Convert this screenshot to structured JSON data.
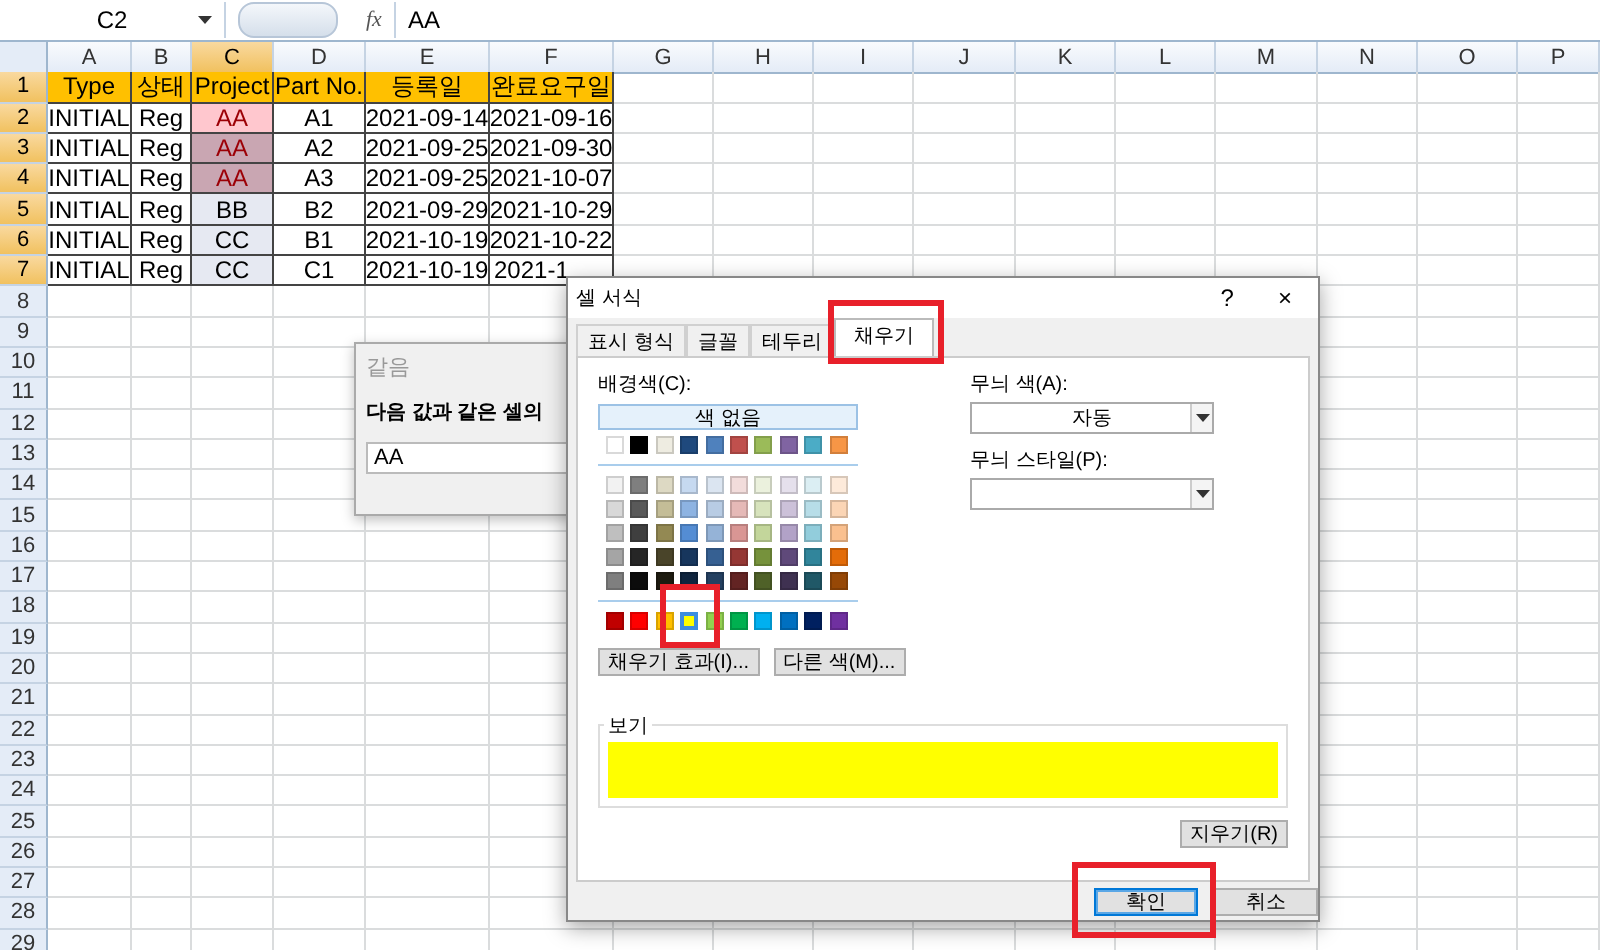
{
  "formula_bar": {
    "name_box": "C2",
    "fx": "fx",
    "value": "AA"
  },
  "sheet": {
    "columns": [
      {
        "label": "A",
        "selected": false
      },
      {
        "label": "B",
        "selected": false
      },
      {
        "label": "C",
        "selected": true
      },
      {
        "label": "D",
        "selected": false
      },
      {
        "label": "E",
        "selected": false
      },
      {
        "label": "F",
        "selected": false
      },
      {
        "label": "G",
        "selected": false
      },
      {
        "label": "H",
        "selected": false
      },
      {
        "label": "I",
        "selected": false
      },
      {
        "label": "J",
        "selected": false
      },
      {
        "label": "K",
        "selected": false
      },
      {
        "label": "L",
        "selected": false
      },
      {
        "label": "M",
        "selected": false
      },
      {
        "label": "N",
        "selected": false
      },
      {
        "label": "O",
        "selected": false
      },
      {
        "label": "P",
        "selected": false
      }
    ],
    "row_numbers": [
      {
        "label": "1",
        "selected": true
      },
      {
        "label": "2",
        "selected": true
      },
      {
        "label": "3",
        "selected": true
      },
      {
        "label": "4",
        "selected": true
      },
      {
        "label": "5",
        "selected": true
      },
      {
        "label": "6",
        "selected": true
      },
      {
        "label": "7",
        "selected": true
      },
      {
        "label": "8",
        "selected": false
      },
      {
        "label": "9",
        "selected": false
      },
      {
        "label": "10",
        "selected": false
      },
      {
        "label": "11",
        "selected": false
      },
      {
        "label": "12",
        "selected": false
      },
      {
        "label": "13",
        "selected": false
      },
      {
        "label": "14",
        "selected": false
      },
      {
        "label": "15",
        "selected": false
      },
      {
        "label": "16",
        "selected": false
      },
      {
        "label": "17",
        "selected": false
      },
      {
        "label": "18",
        "selected": false
      },
      {
        "label": "19",
        "selected": false
      },
      {
        "label": "20",
        "selected": false
      },
      {
        "label": "21",
        "selected": false
      },
      {
        "label": "22",
        "selected": false
      },
      {
        "label": "23",
        "selected": false
      },
      {
        "label": "24",
        "selected": false
      },
      {
        "label": "25",
        "selected": false
      },
      {
        "label": "26",
        "selected": false
      },
      {
        "label": "27",
        "selected": false
      },
      {
        "label": "28",
        "selected": false
      },
      {
        "label": "29",
        "selected": false
      }
    ],
    "rows": [
      {
        "cells": [
          {
            "text": "Type",
            "kind": "header",
            "selected": false
          },
          {
            "text": "상태",
            "kind": "header",
            "selected": false
          },
          {
            "text": "Project",
            "kind": "header",
            "selected": false
          },
          {
            "text": "Part No.",
            "kind": "header",
            "selected": false
          },
          {
            "text": "등록일",
            "kind": "header",
            "selected": false
          },
          {
            "text": "완료요구일",
            "kind": "header",
            "selected": false
          }
        ]
      },
      {
        "cells": [
          {
            "text": "INITIAL",
            "kind": "plain",
            "selected": false
          },
          {
            "text": "Reg",
            "kind": "plain",
            "selected": false
          },
          {
            "text": "AA",
            "kind": "duplicate",
            "selected": false
          },
          {
            "text": "A1",
            "kind": "plain",
            "selected": false
          },
          {
            "text": "2021-09-14",
            "kind": "plain",
            "selected": false
          },
          {
            "text": "2021-09-16",
            "kind": "plain",
            "selected": false
          }
        ]
      },
      {
        "cells": [
          {
            "text": "INITIAL",
            "kind": "plain",
            "selected": false
          },
          {
            "text": "Reg",
            "kind": "plain",
            "selected": false
          },
          {
            "text": "AA",
            "kind": "duplicate",
            "selected": true
          },
          {
            "text": "A2",
            "kind": "plain",
            "selected": false
          },
          {
            "text": "2021-09-25",
            "kind": "plain",
            "selected": false
          },
          {
            "text": "2021-09-30",
            "kind": "plain",
            "selected": false
          }
        ]
      },
      {
        "cells": [
          {
            "text": "INITIAL",
            "kind": "plain",
            "selected": false
          },
          {
            "text": "Reg",
            "kind": "plain",
            "selected": false
          },
          {
            "text": "AA",
            "kind": "duplicate",
            "selected": true
          },
          {
            "text": "A3",
            "kind": "plain",
            "selected": false
          },
          {
            "text": "2021-09-25",
            "kind": "plain",
            "selected": false
          },
          {
            "text": "2021-10-07",
            "kind": "plain",
            "selected": false
          }
        ]
      },
      {
        "cells": [
          {
            "text": "INITIAL",
            "kind": "plain",
            "selected": false
          },
          {
            "text": "Reg",
            "kind": "plain",
            "selected": false
          },
          {
            "text": "BB",
            "kind": "plain",
            "selected": true
          },
          {
            "text": "B2",
            "kind": "plain",
            "selected": false
          },
          {
            "text": "2021-09-29",
            "kind": "plain",
            "selected": false
          },
          {
            "text": "2021-10-29",
            "kind": "plain",
            "selected": false
          }
        ]
      },
      {
        "cells": [
          {
            "text": "INITIAL",
            "kind": "plain",
            "selected": false
          },
          {
            "text": "Reg",
            "kind": "plain",
            "selected": false
          },
          {
            "text": "CC",
            "kind": "plain",
            "selected": true
          },
          {
            "text": "B1",
            "kind": "plain",
            "selected": false
          },
          {
            "text": "2021-10-19",
            "kind": "plain",
            "selected": false
          },
          {
            "text": "2021-10-22",
            "kind": "plain",
            "selected": false
          }
        ]
      },
      {
        "cells": [
          {
            "text": "INITIAL",
            "kind": "plain",
            "selected": false
          },
          {
            "text": "Reg",
            "kind": "plain",
            "selected": false
          },
          {
            "text": "CC",
            "kind": "plain",
            "selected": true
          },
          {
            "text": "C1",
            "kind": "plain",
            "selected": false
          },
          {
            "text": "2021-10-19",
            "kind": "plain",
            "selected": false
          },
          {
            "text": "2021-1",
            "kind": "plain",
            "selected": false
          }
        ]
      }
    ]
  },
  "duplicate_dialog": {
    "title": "같음",
    "prompt": "다음 값과 같은 셀의",
    "value": "AA"
  },
  "format_dialog": {
    "title": "셀 서식",
    "help": "?",
    "close": "×",
    "tabs": [
      {
        "label": "표시 형식",
        "selected": false
      },
      {
        "label": "글꼴",
        "selected": false
      },
      {
        "label": "테두리",
        "selected": false
      },
      {
        "label": "채우기",
        "selected": true
      }
    ],
    "background_label": "배경색(C):",
    "no_color_button": "색 없음",
    "theme_colors": [
      {
        "color": "#ffffff",
        "selected": false
      },
      {
        "color": "#000000",
        "selected": false
      },
      {
        "color": "#eeece1",
        "selected": false
      },
      {
        "color": "#1f497d",
        "selected": false
      },
      {
        "color": "#4f81bd",
        "selected": false
      },
      {
        "color": "#c0504d",
        "selected": false
      },
      {
        "color": "#9bbb59",
        "selected": false
      },
      {
        "color": "#8064a2",
        "selected": false
      },
      {
        "color": "#4bacc6",
        "selected": false
      },
      {
        "color": "#f79646",
        "selected": false
      }
    ],
    "tint_rows": [
      [
        {
          "color": "#f2f2f2",
          "selected": false
        },
        {
          "color": "#7f7f7f",
          "selected": false
        },
        {
          "color": "#ddd9c3",
          "selected": false
        },
        {
          "color": "#c6d9f0",
          "selected": false
        },
        {
          "color": "#dbe5f1",
          "selected": false
        },
        {
          "color": "#f2dcdb",
          "selected": false
        },
        {
          "color": "#ebf1dd",
          "selected": false
        },
        {
          "color": "#e5e0ec",
          "selected": false
        },
        {
          "color": "#dbeef3",
          "selected": false
        },
        {
          "color": "#fdeada",
          "selected": false
        }
      ],
      [
        {
          "color": "#d8d8d8",
          "selected": false
        },
        {
          "color": "#595959",
          "selected": false
        },
        {
          "color": "#c4bd97",
          "selected": false
        },
        {
          "color": "#8db3e2",
          "selected": false
        },
        {
          "color": "#b8cce4",
          "selected": false
        },
        {
          "color": "#e5b9b7",
          "selected": false
        },
        {
          "color": "#d7e3bc",
          "selected": false
        },
        {
          "color": "#ccc1d9",
          "selected": false
        },
        {
          "color": "#b7dde8",
          "selected": false
        },
        {
          "color": "#fbd5b5",
          "selected": false
        }
      ],
      [
        {
          "color": "#bfbfbf",
          "selected": false
        },
        {
          "color": "#3f3f3f",
          "selected": false
        },
        {
          "color": "#938953",
          "selected": false
        },
        {
          "color": "#548dd4",
          "selected": false
        },
        {
          "color": "#95b3d7",
          "selected": false
        },
        {
          "color": "#d99694",
          "selected": false
        },
        {
          "color": "#c3d69b",
          "selected": false
        },
        {
          "color": "#b2a2c7",
          "selected": false
        },
        {
          "color": "#92cddc",
          "selected": false
        },
        {
          "color": "#fac08f",
          "selected": false
        }
      ],
      [
        {
          "color": "#a5a5a5",
          "selected": false
        },
        {
          "color": "#262626",
          "selected": false
        },
        {
          "color": "#494429",
          "selected": false
        },
        {
          "color": "#17365d",
          "selected": false
        },
        {
          "color": "#366092",
          "selected": false
        },
        {
          "color": "#953734",
          "selected": false
        },
        {
          "color": "#76923c",
          "selected": false
        },
        {
          "color": "#5f497a",
          "selected": false
        },
        {
          "color": "#31859b",
          "selected": false
        },
        {
          "color": "#e36c09",
          "selected": false
        }
      ],
      [
        {
          "color": "#7f7f7f",
          "selected": false
        },
        {
          "color": "#0c0c0c",
          "selected": false
        },
        {
          "color": "#1d1b10",
          "selected": false
        },
        {
          "color": "#0f243e",
          "selected": false
        },
        {
          "color": "#244061",
          "selected": false
        },
        {
          "color": "#632423",
          "selected": false
        },
        {
          "color": "#4f6128",
          "selected": false
        },
        {
          "color": "#3f3151",
          "selected": false
        },
        {
          "color": "#205867",
          "selected": false
        },
        {
          "color": "#974806",
          "selected": false
        }
      ]
    ],
    "standard_colors": [
      {
        "color": "#c00000",
        "selected": false
      },
      {
        "color": "#ff0000",
        "selected": false
      },
      {
        "color": "#ffc000",
        "selected": false
      },
      {
        "color": "#ffff00",
        "selected": true
      },
      {
        "color": "#92d050",
        "selected": false
      },
      {
        "color": "#00b050",
        "selected": false
      },
      {
        "color": "#00b0f0",
        "selected": false
      },
      {
        "color": "#0070c0",
        "selected": false
      },
      {
        "color": "#002060",
        "selected": false
      },
      {
        "color": "#7030a0",
        "selected": false
      }
    ],
    "fill_effects_button": "채우기 효과(I)...",
    "more_colors_button": "다른 색(M)...",
    "pattern_color_label": "무늬 색(A):",
    "pattern_color_value": "자동",
    "pattern_style_label": "무늬 스타일(P):",
    "preview_label": "보기",
    "clear_button": "지우기(R)",
    "ok_button": "확인",
    "cancel_button": "취소"
  },
  "annotations": [
    {
      "kind": "tab"
    },
    {
      "kind": "swatch"
    },
    {
      "kind": "ok_button"
    }
  ]
}
